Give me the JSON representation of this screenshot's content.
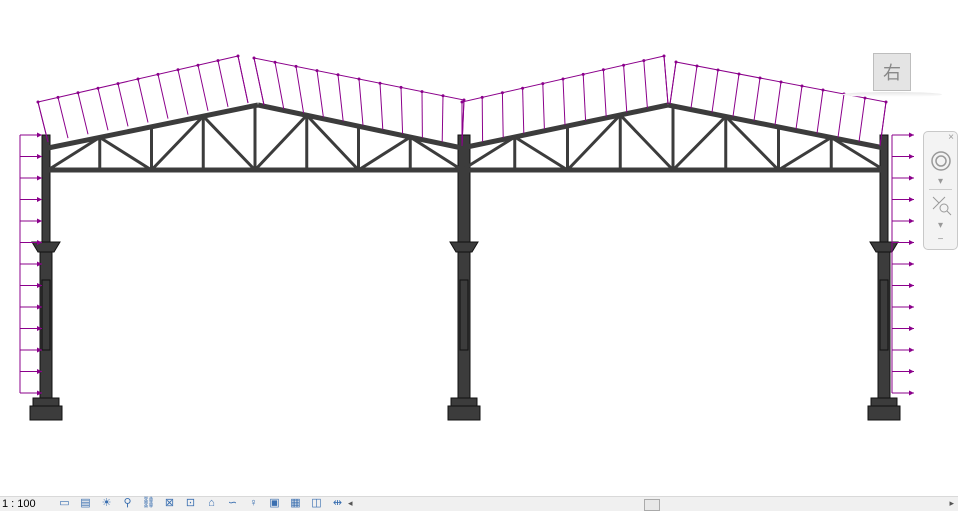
{
  "view": {
    "name": "elevation-frame-with-wind-loads",
    "load_color": "#8b008b",
    "structure_color": "#3c3c3c"
  },
  "viewcube": {
    "label": "右"
  },
  "navbar": {
    "close": "×",
    "wheel_icon": "steering-wheel-icon",
    "zoom_icon": "zoom-region-icon",
    "dropdown": "▾",
    "minimize": "−"
  },
  "statusbar": {
    "scale": "1 : 100",
    "icons": [
      "detail-level-icon",
      "visual-style-icon",
      "sun-path-off-icon",
      "shadows-off-icon",
      "render-icon",
      "crop-view-icon",
      "show-crop-icon",
      "unlock-3d-icon",
      "temporary-hide-icon",
      "reveal-hidden-icon",
      "temporary-view-properties-icon",
      "show-analytical-model-icon",
      "highlight-displacement-icon",
      "reveal-constraints-icon"
    ],
    "icon_glyphs": [
      "▭",
      "▤",
      "☀",
      "⚲",
      "⛓",
      "⊠",
      "⊡",
      "⌂",
      "∽",
      "♀",
      "▣",
      "▦",
      "◫",
      "⇹"
    ],
    "scroll_left": "◂",
    "scroll_right": "▸"
  }
}
